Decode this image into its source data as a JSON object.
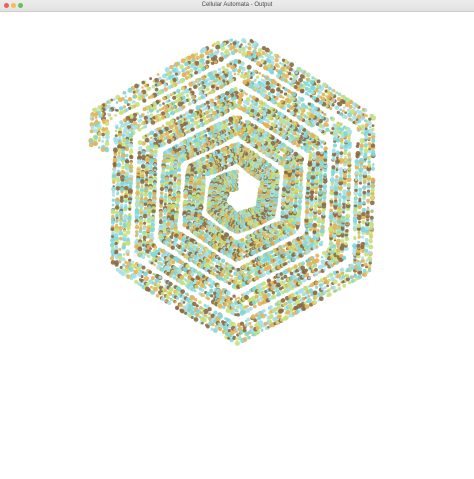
{
  "window": {
    "title": "Cellular Automata - Output",
    "controls": {
      "close_color": "#ee5f57",
      "minimize_color": "#f4bd4f",
      "zoom_color": "#61c454"
    }
  },
  "canvas": {
    "background": "#ffffff",
    "pattern": "hexagonal-spiral-cellular-automaton",
    "cell_colors": [
      "#7fd7d9",
      "#e3b25a",
      "#8a6a45",
      "#c8e07a",
      "#a8e0e8"
    ]
  }
}
